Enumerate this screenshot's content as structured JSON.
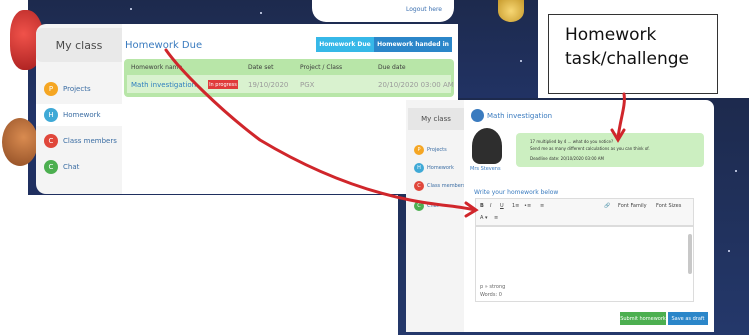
{
  "header": {
    "logout_label": "Logout here"
  },
  "left_app": {
    "my_class": "My class",
    "nav": [
      {
        "label": "Projects",
        "color": "#f5a623",
        "icon": "P"
      },
      {
        "label": "Homework",
        "color": "#3fa9d6",
        "icon": "H"
      },
      {
        "label": "Class members",
        "color": "#e0473b",
        "icon": "C"
      },
      {
        "label": "Chat",
        "color": "#4caf50",
        "icon": "C"
      }
    ],
    "homework_title": "Homework Due",
    "tabs": {
      "due": "Homework Due",
      "handed": "Homework handed in"
    },
    "table": {
      "headers": [
        "Homework name",
        "Date set",
        "Project / Class",
        "Due date"
      ],
      "row": {
        "name": "Math investigation",
        "status": "In progress",
        "date_set": "19/10/2020",
        "project": "PGX",
        "due": "20/10/2020 03:00 AM"
      }
    }
  },
  "callout": {
    "line1": "Homework",
    "line2": "task/challenge"
  },
  "right_app": {
    "my_class": "My class",
    "nav": [
      {
        "label": "Projects",
        "color": "#f5a623",
        "icon": "P"
      },
      {
        "label": "Homework",
        "color": "#3fa9d6",
        "icon": "H"
      },
      {
        "label": "Class members",
        "color": "#e0473b",
        "icon": "C"
      },
      {
        "label": "Chat",
        "color": "#4caf50",
        "icon": "C"
      }
    ],
    "task_title": "Math investigation",
    "teacher_name": "Mrs Stevens",
    "task_text_1": "17 multiplied by 4 ... what do you notice?",
    "task_text_2": "Send me as many different calculations as you can think of.",
    "deadline": "Deadline date: 20/10/2020 03:00 AM",
    "write_label": "Write your homework below",
    "toolbar": {
      "bold": "B",
      "italic": "I",
      "underline": "U",
      "font_family": "Font Family",
      "font_sizes": "Font Sizes",
      "ordered_list": "1≡",
      "unordered_list": "•≡",
      "align": "≡",
      "link": "🔗"
    },
    "editor_line_1": "p » strong",
    "editor_line_2": "Words: 0",
    "submit_label": "Submit homework",
    "draft_label": "Save as draft"
  }
}
